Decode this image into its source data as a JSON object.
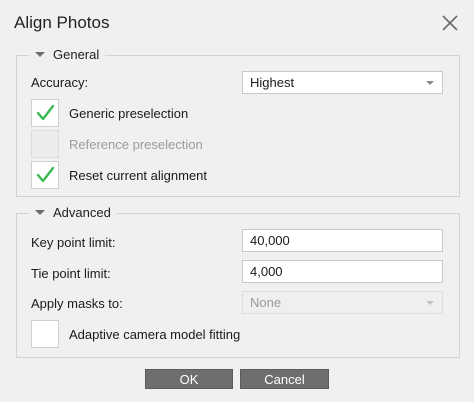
{
  "dialog": {
    "title": "Align Photos"
  },
  "general": {
    "header": "General",
    "accuracy_label": "Accuracy:",
    "accuracy_value": "Highest",
    "generic_preselection": {
      "label": "Generic preselection",
      "checked": true,
      "enabled": true
    },
    "reference_preselection": {
      "label": "Reference preselection",
      "checked": false,
      "enabled": false
    },
    "reset_alignment": {
      "label": "Reset current alignment",
      "checked": true,
      "enabled": true
    }
  },
  "advanced": {
    "header": "Advanced",
    "key_point_label": "Key point limit:",
    "key_point_value": "40,000",
    "tie_point_label": "Tie point limit:",
    "tie_point_value": "4,000",
    "masks_label": "Apply masks to:",
    "masks_value": "None",
    "adaptive_fitting": {
      "label": "Adaptive camera model fitting",
      "checked": false,
      "enabled": true
    }
  },
  "buttons": {
    "ok": "OK",
    "cancel": "Cancel"
  },
  "colors": {
    "check": "#3cba54",
    "button_bg": "#6e6e6e"
  },
  "icons": {
    "close": "close-icon",
    "check": "checkmark-icon",
    "collapse": "caret-down-icon"
  }
}
